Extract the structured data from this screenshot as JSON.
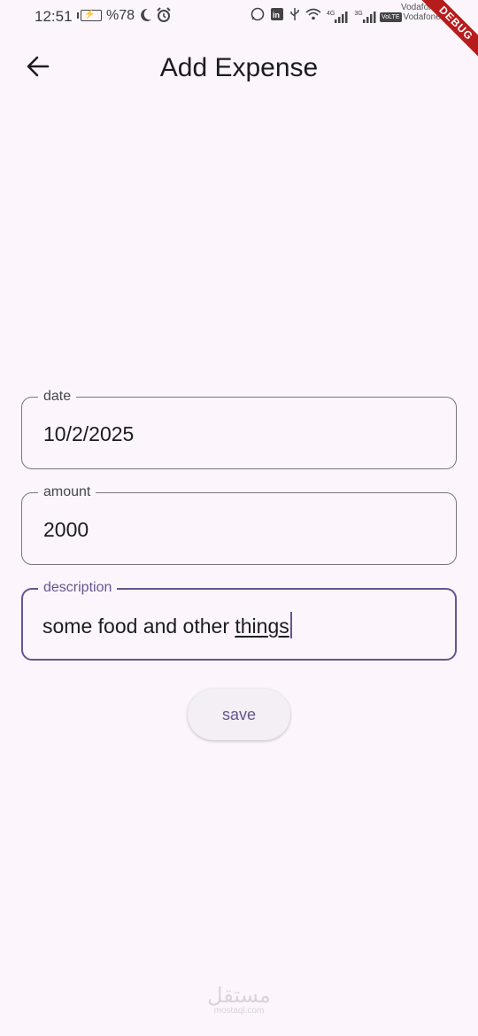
{
  "status_bar": {
    "time": "12:51",
    "battery_percent": "%78",
    "network_4g": "4G",
    "network_3g": "3G",
    "volte": "VoLTE",
    "operator_1": "Vodafone",
    "operator_2": "Vodafone"
  },
  "debug_banner": "DEBUG",
  "app_bar": {
    "title": "Add Expense",
    "back_icon": "arrow-back-icon"
  },
  "form": {
    "date": {
      "label": "date",
      "value": "10/2/2025"
    },
    "amount": {
      "label": "amount",
      "value": "2000"
    },
    "description": {
      "label": "description",
      "value_prefix": "some food and other ",
      "value_composing": "things"
    }
  },
  "save_button": {
    "label": "save"
  },
  "watermark": {
    "logo": "مستقل",
    "sub": "mostaql.com"
  },
  "colors": {
    "background": "#FCF6FC",
    "primary": "#65558F",
    "outline": "#79747E",
    "debug": "#B71C1C"
  }
}
